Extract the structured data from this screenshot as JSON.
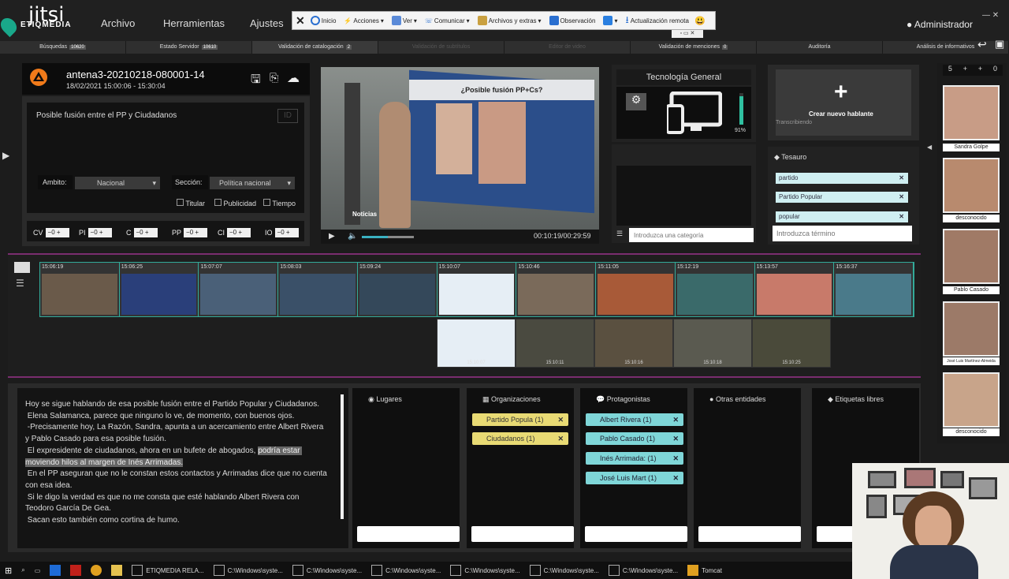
{
  "app": {
    "name": "ETIQMEDIA",
    "jitsi": "jitsi"
  },
  "menu": {
    "items": [
      "Archivo",
      "Herramientas",
      "Ajustes"
    ],
    "user": "Administrador"
  },
  "toolbar": {
    "items": [
      "Inicio",
      "Acciones",
      "Ver",
      "Comunicar",
      "Archivos y extras",
      "Observación",
      "",
      "Actualización remota"
    ]
  },
  "tabs": [
    {
      "label": "Búsquedas",
      "badge": "10620"
    },
    {
      "label": "Estado Servidor",
      "badge": "10610"
    },
    {
      "label": "Validación de catalogación",
      "badge": "2"
    },
    {
      "label": "Validación de subtítulos",
      "badge": ""
    },
    {
      "label": "Editor de video",
      "badge": ""
    },
    {
      "label": "Validación de menciones",
      "badge": "0"
    },
    {
      "label": "Auditoría",
      "badge": ""
    },
    {
      "label": "Análisis de informativos",
      "badge": ""
    }
  ],
  "item": {
    "title": "antena3-20210218-080001-14",
    "datetime": "18/02/2021 15:00:06  -  15:30:04"
  },
  "description": {
    "text": "Posible fusión entre el PP y Ciudadanos",
    "id_label": "ID"
  },
  "fields": {
    "ambito_label": "Ambito:",
    "ambito_value": "Nacional",
    "seccion_label": "Sección:",
    "seccion_value": "Política nacional",
    "titular": "Titular",
    "publicidad": "Publicidad",
    "tiempo": "Tiempo"
  },
  "counters": [
    {
      "label": "CV",
      "value": "0"
    },
    {
      "label": "PI",
      "value": "0"
    },
    {
      "label": "C",
      "value": "0"
    },
    {
      "label": "PP",
      "value": "0"
    },
    {
      "label": "CI",
      "value": "0"
    },
    {
      "label": "IO",
      "value": "0"
    }
  ],
  "video": {
    "headline": "¿Posible fusión PP+Cs?",
    "brand": "Noticias",
    "time": "00:10:19/00:29:59"
  },
  "category": {
    "title": "Tecnología General",
    "percent": "91%",
    "placeholder": "Introduzca una categoría"
  },
  "speaker": {
    "new_label": "Crear nuevo hablante",
    "transcribe": "Transcribiendo"
  },
  "thesaurus": {
    "title": "Tesauro",
    "tags": [
      "partido",
      "Partido Popular",
      "popular"
    ],
    "placeholder": "Introduzca término"
  },
  "speakers_side": {
    "count": "5",
    "names": [
      "Sandra Golpe",
      "desconocido",
      "Pablo Casado",
      "José Luis Martínez-Almeida",
      "desconocido"
    ]
  },
  "timeline": {
    "row1": [
      "15:06:19",
      "15:06:25",
      "15:07:07",
      "15:08:03",
      "15:09:24",
      "15:10:07",
      "15:10:46",
      "15:11:05",
      "15:12:19",
      "15:13:57",
      "15:16:37"
    ],
    "row2": [
      "15:10:07",
      "15:10:11",
      "15:10:16",
      "15:10:18",
      "15:10:25"
    ]
  },
  "transcript": {
    "p1": "Hoy se sigue hablando de esa posible fusión entre el Partido Popular y Ciudadanos.",
    "p2": " Elena Salamanca, parece que ninguno lo ve, de momento, con buenos ojos.",
    "p3": " -Precisamente hoy, La Razón, Sandra, apunta a un acercamiento entre Albert Rivera y Pablo Casado para esa posible fusión.",
    "p4a": " El expresidente de ciudadanos, ahora en un bufete de abogados, ",
    "p4b": "podría estar moviendo hilos al margen de Inés Arrimadas.",
    "p5": " En el PP aseguran que no le constan estos contactos y Arrimadas dice que no cuenta con esa idea.",
    "p6": " Si le digo la verdad es que no me consta que esté hablando Albert Rivera con Teodoro García De Gea.",
    "p7": " Sacan esto también como cortina de humo."
  },
  "entities": {
    "lugares": "Lugares",
    "organizaciones": {
      "title": "Organizaciones",
      "tags": [
        "Partido Popula (1)",
        "Ciudadanos (1)"
      ]
    },
    "protagonistas": {
      "title": "Protagonistas",
      "tags": [
        "Albert Rivera (1)",
        "Pablo Casado (1)",
        "Inés Arrimada: (1)",
        "José Luis Mart (1)"
      ]
    },
    "otras": "Otras entidades",
    "libres": "Etiquetas libres"
  },
  "taskbar": {
    "items": [
      "ETIQMEDIA RELA...",
      "C:\\Windows\\syste...",
      "C:\\Windows\\syste...",
      "C:\\Windows\\syste...",
      "C:\\Windows\\syste...",
      "C:\\Windows\\syste...",
      "C:\\Windows\\syste...",
      "Tomcat"
    ]
  }
}
